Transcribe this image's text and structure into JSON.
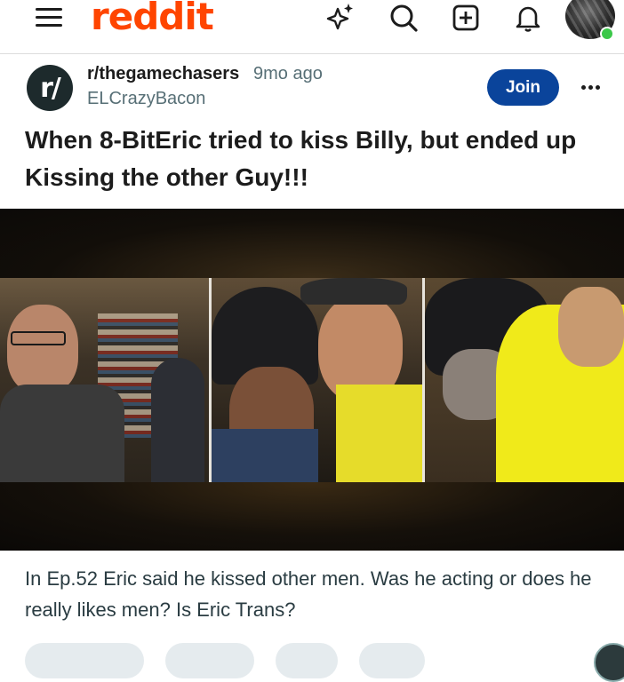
{
  "header": {
    "logo_text": "reddit",
    "icons": [
      "menu-icon",
      "answers-sparkle-icon",
      "search-icon",
      "create-post-icon",
      "notifications-bell-icon",
      "user-avatar"
    ],
    "brand_color": "#ff4500"
  },
  "post": {
    "subreddit": "r/thegamechasers",
    "subreddit_icon_text": "r/",
    "age": "9mo ago",
    "author": "ELCrazyBacon",
    "join_label": "Join",
    "title": "When 8-BitEric tried to kiss Billy, but ended up Kissing the other Guy!!!",
    "body": "In Ep.52 Eric said he kissed other men. Was he acting or does he really likes men? Is Eric Trans?",
    "join_color": "#0a449b"
  }
}
